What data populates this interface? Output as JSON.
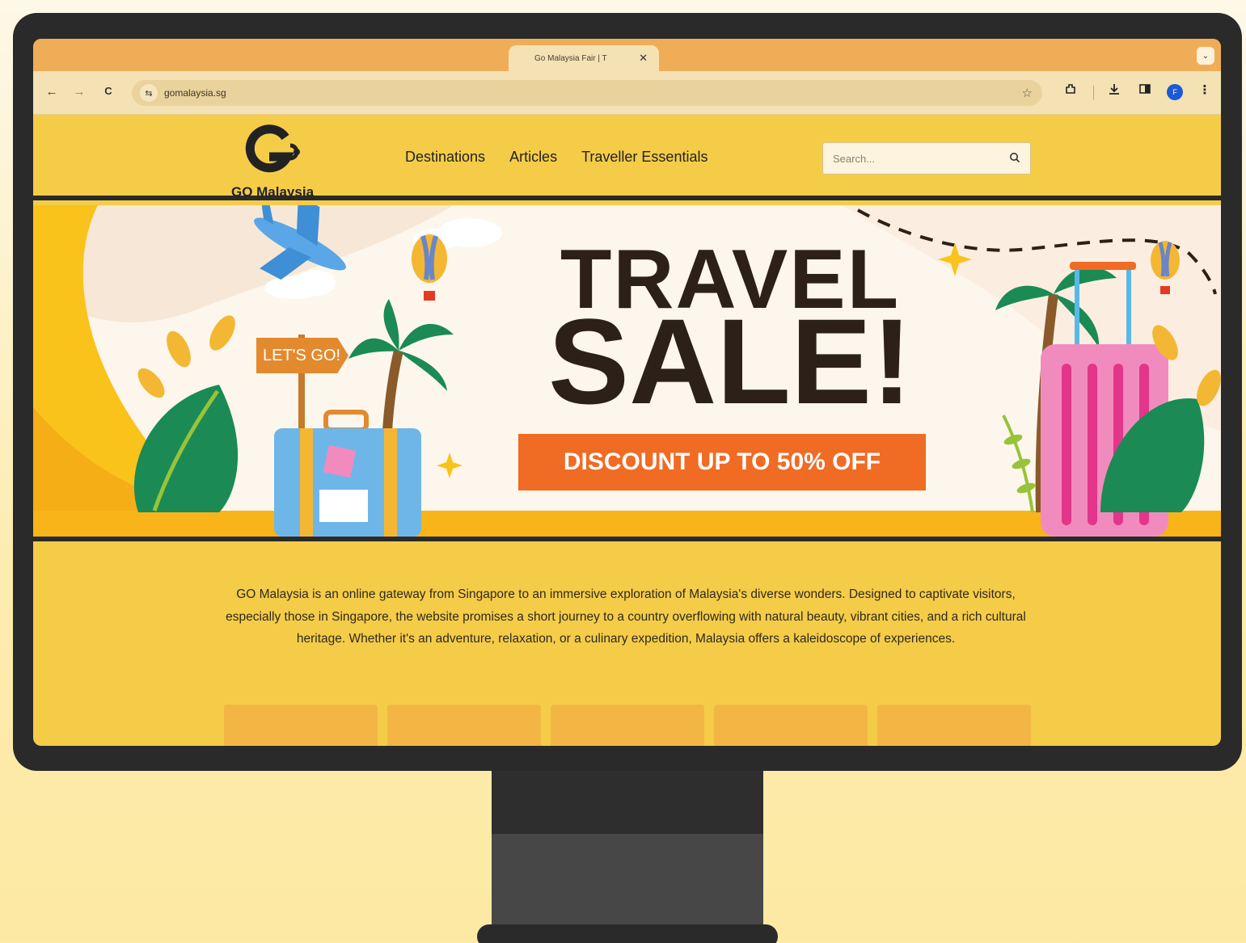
{
  "browser": {
    "tab_title": "Go Malaysia Fair | T",
    "tab_close": "✕",
    "tab_menu": "⌄",
    "back": "←",
    "forward": "→",
    "reload": "C",
    "site_info": "⇆",
    "url": "gomalaysia.sg",
    "bookmark": "☆",
    "profile_initial": "F",
    "menu": "⋮"
  },
  "site": {
    "logo_text": "GO Malaysia",
    "nav": [
      "Destinations",
      "Articles",
      "Traveller Essentials"
    ],
    "search_placeholder": "Search...",
    "accent_color": "#f5cc48"
  },
  "banner": {
    "sign": "LET'S GO!",
    "line1": "TRAVEL",
    "line2": "SALE!",
    "cta": "DISCOUNT UP TO 50% OFF",
    "cta_color": "#f06b24"
  },
  "intro": "GO Malaysia is an online gateway from Singapore to an immersive exploration of Malaysia's diverse wonders. Designed to captivate visitors, especially those in Singapore, the website promises a short journey to a country overflowing with natural beauty, vibrant cities, and a rich cultural heritage. Whether it's an adventure, relaxation, or a culinary expedition, Malaysia offers a kaleidoscope of experiences."
}
